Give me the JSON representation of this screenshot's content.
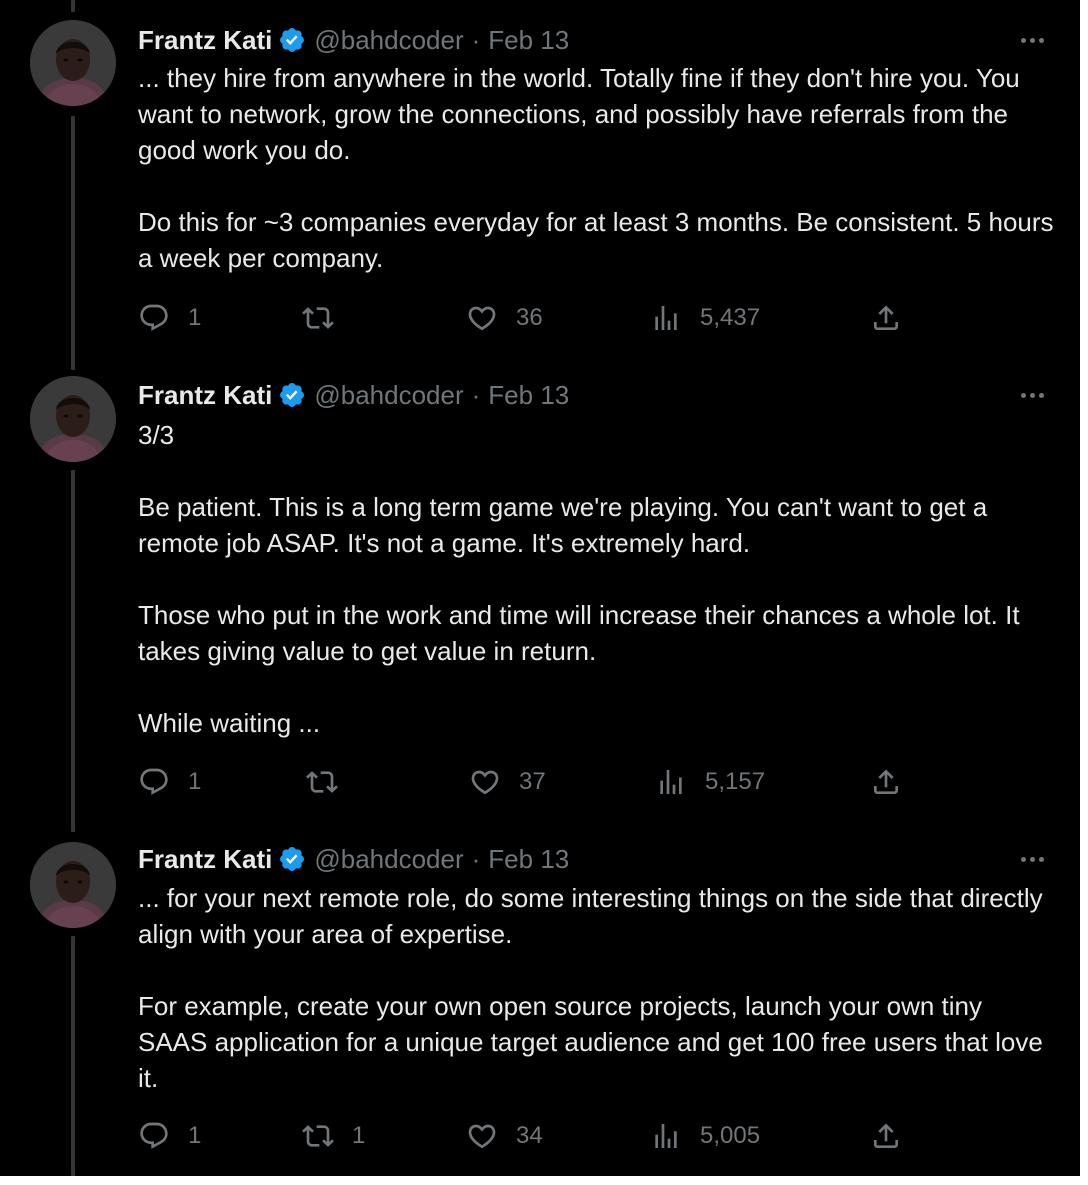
{
  "colors": {
    "background": "#000000",
    "text": "#e7e9ea",
    "muted": "#71767b",
    "verified": "#1d9bf0",
    "thread_line": "#333639"
  },
  "icons": {
    "reply": "reply-icon",
    "retweet": "retweet-icon",
    "like": "like-icon",
    "views": "views-icon",
    "share": "share-icon",
    "more": "more-icon",
    "verified": "verified-badge-icon"
  },
  "tweets": [
    {
      "name": "Frantz Kati",
      "handle": "@bahdcoder",
      "separator": "·",
      "date": "Feb 13",
      "paragraphs": [
        "... they hire from anywhere in the world. Totally fine if they don't hire you. You want to network, grow the connections, and possibly have referrals from the good work you do.",
        "Do this for ~3 companies everyday for at least 3 months. Be consistent. 5 hours a week per company."
      ],
      "replies": "1",
      "retweets": "",
      "likes": "36",
      "views": "5,437"
    },
    {
      "name": "Frantz Kati",
      "handle": "@bahdcoder",
      "separator": "·",
      "date": "Feb 13",
      "paragraphs": [
        "3/3",
        "Be patient. This is a long term game we're playing. You can't want to get a remote job ASAP. It's not a game. It's extremely hard.",
        "Those who put in the work and time will increase their chances a whole lot. It takes giving value to get value in return.",
        "While waiting ..."
      ],
      "replies": "1",
      "retweets": "",
      "likes": "37",
      "views": "5,157"
    },
    {
      "name": "Frantz Kati",
      "handle": "@bahdcoder",
      "separator": "·",
      "date": "Feb 13",
      "paragraphs": [
        "... for your next remote role, do some interesting things on the side that directly align with your area of expertise.",
        "For example, create your own open source projects, launch your own tiny SAAS application for a unique target audience and get 100 free users that love it."
      ],
      "replies": "1",
      "retweets": "1",
      "likes": "34",
      "views": "5,005"
    }
  ]
}
